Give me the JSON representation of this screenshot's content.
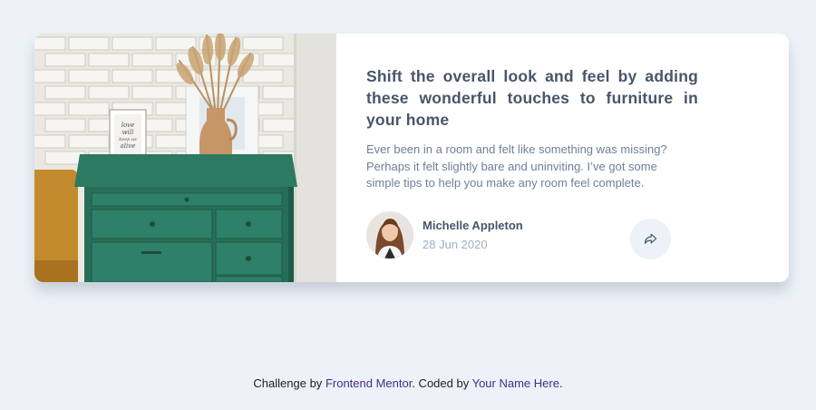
{
  "article": {
    "title": "Shift the overall look and feel by adding these wonderful touches to furniture in your home",
    "description": "Ever been in a room and felt like something was missing? Perhaps it felt slightly bare and uninviting. I’ve got some simple tips to help you make any room feel complete.",
    "image_icon": "drawers-photo",
    "frame_text": [
      "love",
      "will",
      "keep us",
      "alive"
    ]
  },
  "author": {
    "name": "Michelle Appleton",
    "date": "28 Jun 2020",
    "avatar_icon": "avatar-photo"
  },
  "share": {
    "icon": "share-icon"
  },
  "footer": {
    "prefix": "Challenge by",
    "link1": "Frontend Mentor",
    "middle": ". Coded by",
    "link2": "Your Name Here",
    "suffix": "."
  },
  "colors": {
    "background": "#ecf2f8",
    "title": "#48556a",
    "text": "#6e8098",
    "muted": "#9eafc2",
    "link": "#4a2c83"
  }
}
